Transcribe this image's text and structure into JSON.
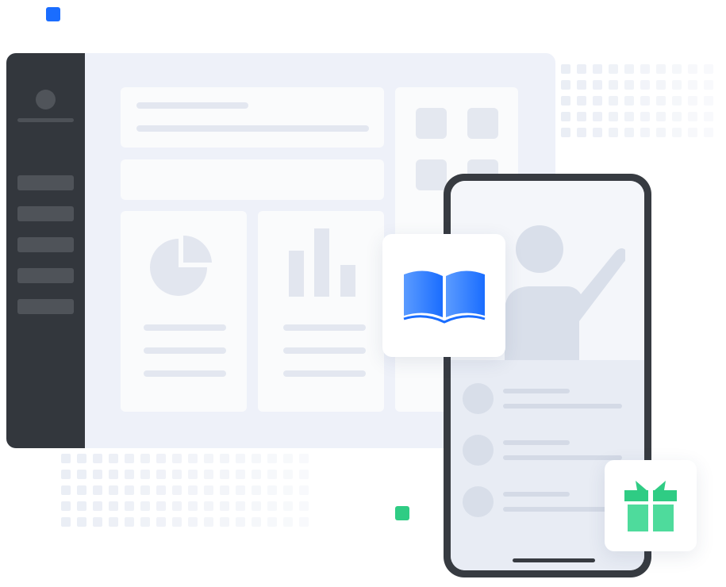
{
  "illustration": {
    "icons": {
      "book": "open-book-icon",
      "gift": "gift-icon",
      "pie": "pie-chart-icon",
      "bars": "bar-chart-icon",
      "person": "person-pointing-icon"
    },
    "colors": {
      "accent_blue": "#1a6dff",
      "accent_green": "#2fcc84",
      "sidebar_dark": "#33373d",
      "phone_frame": "#373b41",
      "panel_bg": "#eef1f9"
    }
  }
}
